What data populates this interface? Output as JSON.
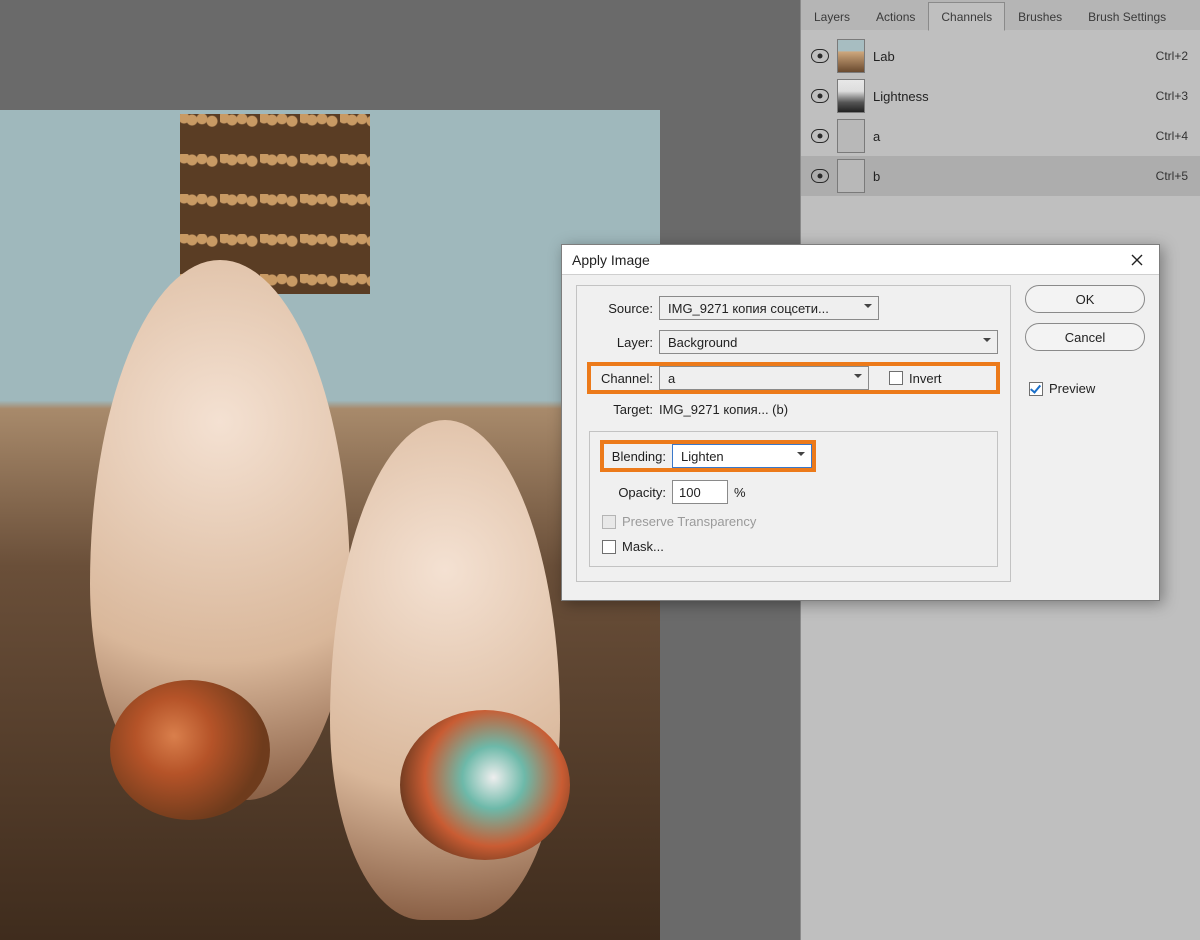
{
  "panel": {
    "tabs": [
      "Layers",
      "Actions",
      "Channels",
      "Brushes",
      "Brush Settings"
    ],
    "active_tab_index": 2,
    "channels": [
      {
        "name": "Lab",
        "shortcut": "Ctrl+2",
        "thumb": "lab"
      },
      {
        "name": "Lightness",
        "shortcut": "Ctrl+3",
        "thumb": "light"
      },
      {
        "name": "a",
        "shortcut": "Ctrl+4",
        "thumb": "flat"
      },
      {
        "name": "b",
        "shortcut": "Ctrl+5",
        "thumb": "flat",
        "selected": true
      }
    ]
  },
  "dialog": {
    "title": "Apply Image",
    "source_label": "Source:",
    "source_value": "IMG_9271 копия соцсети...",
    "layer_label": "Layer:",
    "layer_value": "Background",
    "channel_label": "Channel:",
    "channel_value": "a",
    "invert_label": "Invert",
    "invert_checked": false,
    "target_label": "Target:",
    "target_value": "IMG_9271 копия... (b)",
    "blending_label": "Blending:",
    "blending_value": "Lighten",
    "opacity_label": "Opacity:",
    "opacity_value": "100",
    "opacity_unit": "%",
    "preserve_label": "Preserve Transparency",
    "mask_label": "Mask...",
    "ok_label": "OK",
    "cancel_label": "Cancel",
    "preview_label": "Preview",
    "preview_checked": true
  }
}
